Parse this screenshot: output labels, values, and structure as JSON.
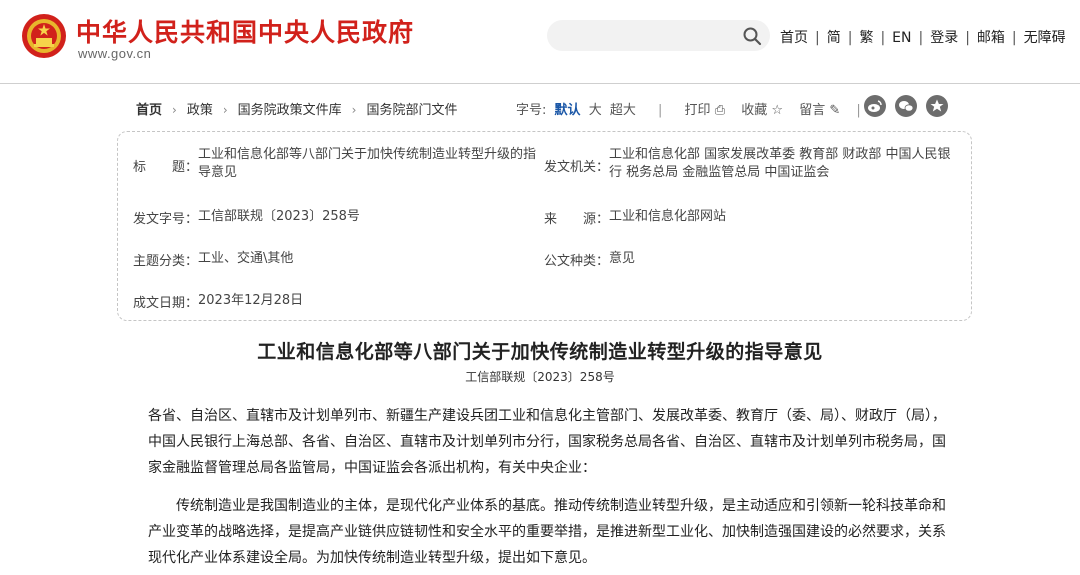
{
  "header": {
    "site_title": "中华人民共和国中央人民政府",
    "site_url": "www.gov.cn",
    "search_placeholder": "",
    "nav": [
      "首页",
      "简",
      "繁",
      "EN",
      "登录",
      "邮箱",
      "无障碍"
    ]
  },
  "breadcrumb": [
    "首页",
    "政策",
    "国务院政策文件库",
    "国务院部门文件"
  ],
  "toolbar": {
    "font_label": "字号:",
    "font_default": "默认",
    "font_large": "大",
    "font_xlarge": "超大",
    "print": "打印",
    "favorite": "收藏",
    "comment": "留言",
    "share_icons": [
      "weibo-icon",
      "wechat-icon",
      "more-icon"
    ]
  },
  "info": {
    "title_label": "标　　题：",
    "title_value": "工业和信息化部等八部门关于加快传统制造业转型升级的指导意见",
    "issuer_label": "发文机关：",
    "issuer_value": "工业和信息化部 国家发展改革委 教育部 财政部 中国人民银行 税务总局 金融监管总局 中国证监会",
    "docno_label": "发文字号：",
    "docno_value": "工信部联规〔2023〕258号",
    "source_label": "来　　源：",
    "source_value": "工业和信息化部网站",
    "topic_label": "主题分类：",
    "topic_value": "工业、交通\\其他",
    "type_label": "公文种类：",
    "type_value": "意见",
    "date_label": "成文日期：",
    "date_value": "2023年12月28日"
  },
  "document": {
    "title": "工业和信息化部等八部门关于加快传统制造业转型升级的指导意见",
    "number": "工信部联规〔2023〕258号",
    "addressees": "各省、自治区、直辖市及计划单列市、新疆生产建设兵团工业和信息化主管部门、发展改革委、教育厅（委、局）、财政厅（局），中国人民银行上海总部、各省、自治区、直辖市及计划单列市分行，国家税务总局各省、自治区、直辖市及计划单列市税务局，国家金融监督管理总局各监管局，中国证监会各派出机构，有关中央企业：",
    "intro": "传统制造业是我国制造业的主体，是现代化产业体系的基底。推动传统制造业转型升级，是主动适应和引领新一轮科技革命和产业变革的战略选择，是提高产业链供应链韧性和安全水平的重要举措，是推进新型工业化、加快制造强国建设的必然要求，关系现代化产业体系建设全局。为加快传统制造业转型升级，提出如下意见。"
  },
  "colors": {
    "brand_red": "#d1211b",
    "link_blue": "#1a57a7"
  }
}
